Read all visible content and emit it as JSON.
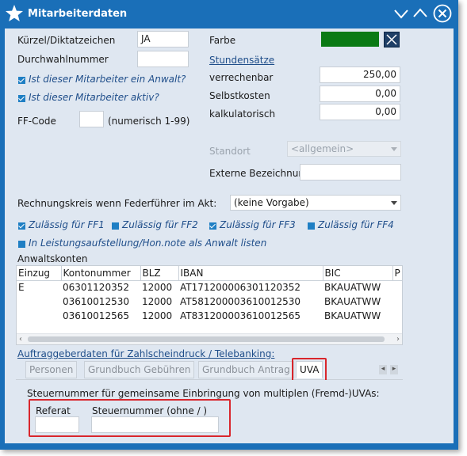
{
  "window": {
    "title": "Mitarbeiterdaten"
  },
  "fields": {
    "kuerzel_label": "Kürzel/Diktatzeichen",
    "kuerzel_value": "JA",
    "durchwahl_label": "Durchwahlnummer",
    "durchwahl_value": "",
    "anwalt_label": "Ist dieser Mitarbeiter ein Anwalt?",
    "aktiv_label": "Ist dieser Mitarbeiter aktiv?",
    "ffcode_label": "FF-Code",
    "ffcode_value": "",
    "ffcode_hint": "(numerisch 1-99)",
    "farbe_label": "Farbe",
    "farbe_color": "#0a7a14",
    "stundensaetze_label": "Stundensätze",
    "verrechenbar_label": "verrechenbar",
    "verrechenbar_value": "250,00",
    "selbstkosten_label": "Selbstkosten",
    "selbstkosten_value": "0,00",
    "kalkulatorisch_label": "kalkulatorisch",
    "kalkulatorisch_value": "0,00",
    "standort_label": "Standort",
    "standort_value": "<allgemein>",
    "externe_label": "Externe Bezeichnun",
    "externe_value": "",
    "rechnungskreis_label": "Rechnungskreis wenn Federführer im Akt:",
    "rechnungskreis_value": "(keine Vorgabe)"
  },
  "ff_checks": [
    {
      "label": "Zulässig für FF1",
      "checked": true
    },
    {
      "label": "Zulässig für FF2",
      "checked": false
    },
    {
      "label": "Zulässig für FF3",
      "checked": true
    },
    {
      "label": "Zulässig für FF4",
      "checked": false
    }
  ],
  "leistung_label": "In Leistungsaufstellung/Hon.note als Anwalt listen",
  "anwaltskonten": {
    "title": "Anwaltskonten",
    "columns": [
      "Einzug",
      "Kontonummer",
      "BLZ",
      "IBAN",
      "BIC",
      "P"
    ],
    "rows": [
      [
        "E",
        "06301120352",
        "12000",
        "AT171200006301120352",
        "BKAUATWW"
      ],
      [
        "",
        "03610012530",
        "12000",
        "AT581200003610012530",
        "BKAUATWW"
      ],
      [
        "",
        "03610012565",
        "12000",
        "AT831200003610012565",
        "BKAUATWW"
      ]
    ]
  },
  "auftraggeber_label": "Auftraggeberdaten für Zahlscheindruck / Telebanking:",
  "tabs": [
    "Personen",
    "Grundbuch Gebühren",
    "Grundbuch Antrag",
    "UVA"
  ],
  "uva": {
    "heading": "Steuernummer für gemeinsame Einbringung von multiplen (Fremd-)UVAs:",
    "referat_label": "Referat",
    "steuernummer_label": "Steuernummer (ohne / )",
    "referat_value": "",
    "steuernummer_value": ""
  },
  "colors": {
    "titlebar": "#1a6fb8",
    "panel": "#dfe7f1",
    "highlight": "#d9262c"
  }
}
